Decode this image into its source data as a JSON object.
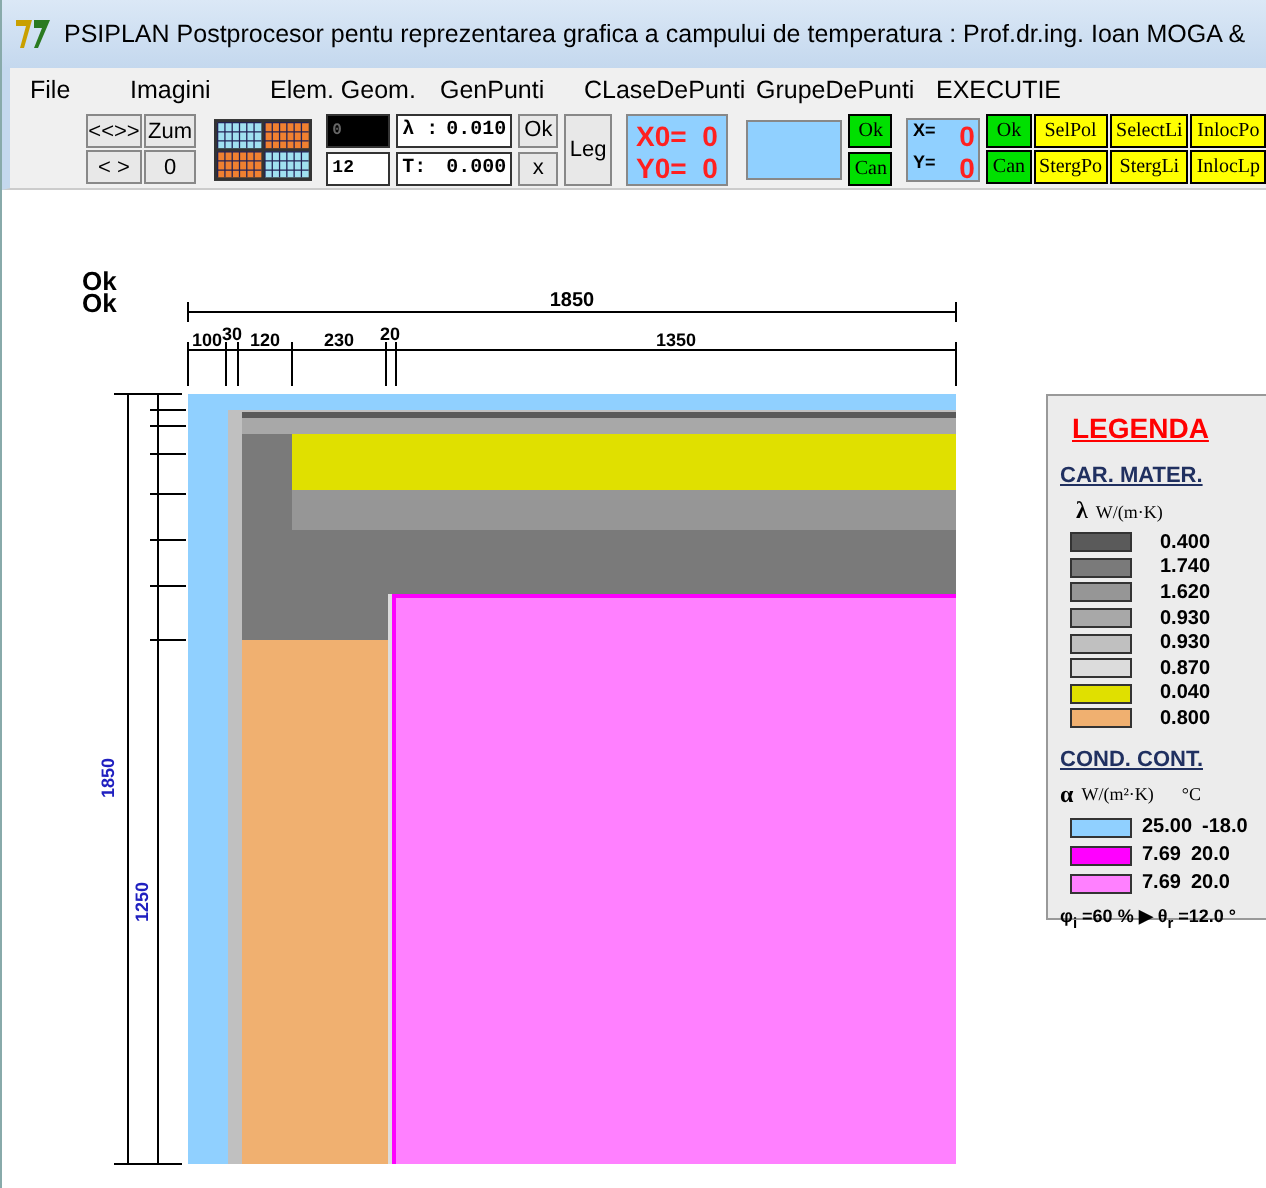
{
  "window": {
    "title": "PSIPLAN  Postprocesor pentu reprezentarea grafica a campului de temperatura : Prof.dr.ing. Ioan MOGA &"
  },
  "menu": [
    "File",
    "Imagini",
    "Elem. Geom.",
    "GenPunti",
    "CLaseDePunti",
    "GrupeDePunti",
    "EXECUTIE"
  ],
  "toolbar": {
    "nav": [
      "<<>>",
      "Zum",
      "< >",
      "0"
    ],
    "color_field": "0",
    "size_field": "12",
    "lambda_label": "λ :",
    "lambda_value": "0.010",
    "t_label": "T:",
    "t_value": "0.000",
    "ok": "Ok",
    "x": "x",
    "leg": "Leg",
    "x0": "X0=  0",
    "y0": "Y0=  0",
    "ok2": "Ok",
    "can2": "Can",
    "x_label": "X=",
    "x_value": "0",
    "y_label": "Y=",
    "y_value": "0",
    "actions": [
      {
        "label": "Ok",
        "color": "#00e000"
      },
      {
        "label": "SelPol",
        "color": "#ffff00"
      },
      {
        "label": "SelectLi",
        "color": "#ffff00"
      },
      {
        "label": "InlocPo",
        "color": "#ffff00"
      },
      {
        "label": "Can",
        "color": "#00e000"
      },
      {
        "label": "StergPo",
        "color": "#ffff00"
      },
      {
        "label": "StergLi",
        "color": "#ffff00"
      },
      {
        "label": "InlocLp",
        "color": "#ffff00"
      }
    ]
  },
  "status": [
    "Ok",
    "Ok"
  ],
  "dimensions": {
    "total": "1850",
    "parts": [
      "100",
      "30",
      "120",
      "230",
      "20",
      "1350"
    ],
    "vertical": [
      "1850",
      "1250"
    ]
  },
  "legend": {
    "title": "LEGENDA",
    "materials_title": "CAR. MATER.",
    "lambda_symbol": "λ",
    "lambda_unit": "W/(m·K)",
    "materials": [
      {
        "color": "#5a5a5a",
        "value": "0.400"
      },
      {
        "color": "#7a7a7a",
        "value": "1.740"
      },
      {
        "color": "#969696",
        "value": "1.620"
      },
      {
        "color": "#a8a8a8",
        "value": "0.930"
      },
      {
        "color": "#c0c0c0",
        "value": "0.930"
      },
      {
        "color": "#dcdcdc",
        "value": "0.870"
      },
      {
        "color": "#e0e000",
        "value": "0.040"
      },
      {
        "color": "#f0b070",
        "value": "0.800"
      }
    ],
    "conditions_title": "COND. CONT.",
    "alpha_symbol": "α",
    "alpha_unit": "W/(m²·K)",
    "temp_unit": "°C",
    "conditions": [
      {
        "color": "#90d0ff",
        "alpha": "25.00",
        "temp": "-18.0"
      },
      {
        "color": "#ff00ff",
        "alpha": "7.69",
        "temp": "20.0"
      },
      {
        "color": "#ff80ff",
        "alpha": "7.69",
        "temp": "20.0"
      }
    ],
    "footer": "φ$_{i}$ =60 % ▶ θ$_{r}$ =12.0 °"
  }
}
